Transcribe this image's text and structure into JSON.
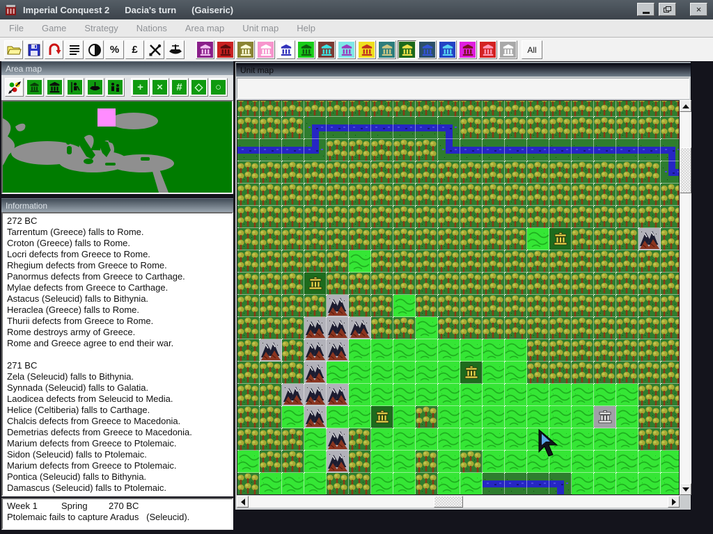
{
  "window": {
    "title": "Imperial Conquest 2",
    "turn_label": "Dacia's turn",
    "player_label": "(Gaiseric)",
    "close_glyph": "×"
  },
  "menu": {
    "items": [
      "File",
      "Game",
      "Strategy",
      "Nations",
      "Area map",
      "Unit map",
      "Help"
    ]
  },
  "toolbar": {
    "utility": [
      {
        "name": "open-folder",
        "kind": "folder"
      },
      {
        "name": "save",
        "kind": "floppy"
      },
      {
        "name": "undo",
        "kind": "undo"
      },
      {
        "name": "report-lines",
        "kind": "lines"
      },
      {
        "name": "contrast",
        "kind": "contrast"
      },
      {
        "name": "percent",
        "kind": "text",
        "label": "%"
      },
      {
        "name": "pound",
        "kind": "text",
        "label": "£"
      },
      {
        "name": "tools",
        "kind": "tools"
      },
      {
        "name": "ship",
        "kind": "ship"
      }
    ],
    "nations": [
      {
        "bg": "#8a1f8a",
        "fg": "#f0c0f0",
        "pressed": false
      },
      {
        "bg": "#c92121",
        "fg": "#5a0d0d",
        "pressed": false
      },
      {
        "bg": "#8a8433",
        "fg": "#fdfdd8",
        "pressed": false
      },
      {
        "bg": "#f795cd",
        "fg": "#ffffff",
        "pressed": false
      },
      {
        "bg": "#ffffff",
        "fg": "#3333bb",
        "pressed": false
      },
      {
        "bg": "#19cc19",
        "fg": "#0e5c0e",
        "pressed": false
      },
      {
        "bg": "#7a3a33",
        "fg": "#3ce2e2",
        "pressed": false
      },
      {
        "bg": "#7fe8e8",
        "fg": "#9c3bbd",
        "pressed": false
      },
      {
        "bg": "#efdf1f",
        "fg": "#c03020",
        "pressed": false
      },
      {
        "bg": "#2d7d7d",
        "fg": "#cdc684",
        "pressed": false
      },
      {
        "bg": "#1c691c",
        "fg": "#efe04a",
        "pressed": true
      },
      {
        "bg": "#2c4f68",
        "fg": "#3354d6",
        "pressed": false
      },
      {
        "bg": "#2343c4",
        "fg": "#59d3f2",
        "pressed": false
      },
      {
        "bg": "#df1fdf",
        "fg": "#7a1020",
        "pressed": false
      },
      {
        "bg": "#d32222",
        "fg": "#ff9ab5",
        "pressed": false
      },
      {
        "bg": "#a9a9a9",
        "fg": "#ffffff",
        "pressed": false
      }
    ],
    "all_label": "All"
  },
  "area_map": {
    "title": "Area map",
    "tools": [
      {
        "name": "view-cycle",
        "kind": "cycle"
      },
      {
        "name": "cities-view",
        "kind": "temple"
      },
      {
        "name": "capitals-view",
        "kind": "columns"
      },
      {
        "name": "armies-view",
        "kind": "soldier"
      },
      {
        "name": "navies-view",
        "kind": "ship"
      },
      {
        "name": "population-view",
        "kind": "people"
      },
      {
        "name": "grid-plus",
        "kind": "glyph",
        "label": "+"
      },
      {
        "name": "grid-x",
        "kind": "glyph",
        "label": "×"
      },
      {
        "name": "grid-hash",
        "kind": "glyph",
        "label": "#"
      },
      {
        "name": "grid-diamond",
        "kind": "glyph",
        "label": "◇"
      },
      {
        "name": "grid-circle",
        "kind": "glyph",
        "label": "○"
      }
    ],
    "colors": {
      "land": "#007c00",
      "sea": "#8f8f8f",
      "highlight": "#ff8cff"
    }
  },
  "information": {
    "title": "Information",
    "lines": [
      "272 BC",
      "Tarrentum (Greece) falls to Rome.",
      "Croton (Greece) falls to Rome.",
      "Locri defects from Greece to Rome.",
      "Rhegium defects from Greece to Rome.",
      "Panormus defects from Greece to Carthage.",
      "Mylae defects from Greece to Carthage.",
      "Astacus (Seleucid) falls to Bithynia.",
      "Heraclea (Greece) falls to Rome.",
      "Thurii defects from Greece to Rome.",
      "Rome destroys army of Greece.",
      "Rome and Greece agree to end their war.",
      "",
      "271 BC",
      "Zela (Seleucid) falls to Bithynia.",
      "Synnada (Seleucid) falls to Galatia.",
      "Laodicea defects from Seleucid to Media.",
      "Helice (Celtiberia) falls to Carthage.",
      "Chalcis defects from Greece to Macedonia.",
      "Demetrias defects from Greece to Macedonia.",
      "Marium defects from Greece to Ptolemaic.",
      "Sidon (Seleucid) falls to Ptolemaic.",
      "Marium defects from Greece to Ptolemaic.",
      "Pontica (Seleucid) falls to Bithynia.",
      "Damascus (Seleucid) falls to Ptolemaic."
    ]
  },
  "status": {
    "week": "Week 1",
    "season": "Spring",
    "year": "270 BC",
    "message": "Ptolemaic fails to capture Aradus   (Seleucid)."
  },
  "unit_map": {
    "title": "Unit map",
    "legend": {
      "F": "forest",
      "G": "hills",
      "M": "mountain",
      "R": "river-horizontal",
      "q": "river-bend-bottom-right",
      "d": "river-bend-left-bottom",
      "p": "river-bend-left-top",
      "u": "river-bend-top-right",
      "C": "city-green",
      "K": "city-gray"
    },
    "grid": [
      "FFFFFFFFFFFFFFFFFFFF",
      "FFFqRRRRRdFFFFFFFFFF",
      "RRRpFFFFFuRRRRRRRRRd",
      "FFFFFFFFFFFFFFFFFFFu",
      "FFFFFFFFFFFFFFFFFFFF",
      "FFFFFFFFFFFFFFFFFFFF",
      "FFFFFFFFFFFFFGCFFFMF",
      "FFFFFGFFFFFFFFFFFFFF",
      "FFFCFFFFFFFFFFFFFFFF",
      "FFFFMFFGFFFFFFFFFFFF",
      "FFFMMMFFGFFFFFFFFFFF",
      "FMFMMGGGGGGGGFFFFFFF",
      "FFFMGGGGGGCGGFFFFFFF",
      "FFMMMGGGGGGGGGGGGGFF",
      "FFGMGGCGFGGGGGGGKGFF",
      "FFFGMFGGGGGGGGGGGGFF",
      "GFFGMFGGFGFGGGGGGGGG",
      "FGGGFFGGFGGRRRdGGGGG"
    ]
  }
}
